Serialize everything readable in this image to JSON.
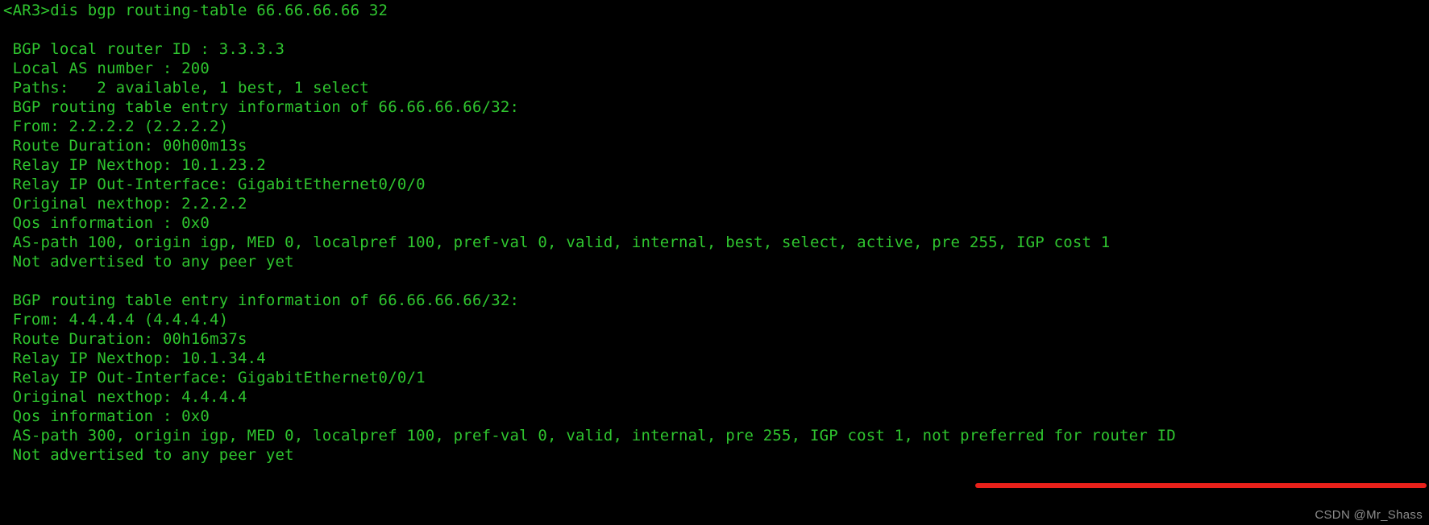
{
  "terminal": {
    "background_color": "#000000",
    "text_color": "#2fc52f",
    "annotation_color": "#e8201a",
    "watermark_color": "#8d8d8d",
    "prompt": "<AR3>",
    "command": "dis bgp routing-table 66.66.66.66 32",
    "command_line": "<AR3>dis bgp routing-table 66.66.66.66 32",
    "lines": [
      "<AR3>dis bgp routing-table 66.66.66.66 32",
      "",
      " BGP local router ID : 3.3.3.3",
      " Local AS number : 200",
      " Paths:   2 available, 1 best, 1 select",
      " BGP routing table entry information of 66.66.66.66/32:",
      " From: 2.2.2.2 (2.2.2.2)",
      " Route Duration: 00h00m13s",
      " Relay IP Nexthop: 10.1.23.2",
      " Relay IP Out-Interface: GigabitEthernet0/0/0",
      " Original nexthop: 2.2.2.2",
      " Qos information : 0x0",
      " AS-path 100, origin igp, MED 0, localpref 100, pref-val 0, valid, internal, best, select, active, pre 255, IGP cost 1",
      " Not advertised to any peer yet",
      "",
      " BGP routing table entry information of 66.66.66.66/32:",
      " From: 4.4.4.4 (4.4.4.4)",
      " Route Duration: 00h16m37s",
      " Relay IP Nexthop: 10.1.34.4",
      " Relay IP Out-Interface: GigabitEthernet0/0/1",
      " Original nexthop: 4.4.4.4",
      " Qos information : 0x0",
      " AS-path 300, origin igp, MED 0, localpref 100, pref-val 0, valid, internal, pre 255, IGP cost 1, not preferred for router ID",
      " Not advertised to any peer yet"
    ],
    "summary": {
      "bgp_local_router_id_label": "BGP local router ID",
      "bgp_local_router_id": "3.3.3.3",
      "local_as_number_label": "Local AS number",
      "local_as_number": "200",
      "paths_label": "Paths:",
      "paths_available": "2 available",
      "paths_best": "1 best",
      "paths_select": "1 select"
    },
    "entries": [
      {
        "header": "BGP routing table entry information of 66.66.66.66/32:",
        "prefix": "66.66.66.66/32",
        "from": "2.2.2.2 (2.2.2.2)",
        "route_duration": "00h00m13s",
        "relay_ip_nexthop": "10.1.23.2",
        "relay_ip_out_interface": "GigabitEthernet0/0/0",
        "original_nexthop": "2.2.2.2",
        "qos_information": "0x0",
        "as_path_line": "AS-path 100, origin igp, MED 0, localpref 100, pref-val 0, valid, internal, best, select, active, pre 255, IGP cost 1",
        "as_path": "100",
        "origin": "igp",
        "med": "0",
        "localpref": "100",
        "pref_val": "0",
        "flags": "valid, internal, best, select, active",
        "pre": "255",
        "igp_cost": "1",
        "advertised": "Not advertised to any peer yet"
      },
      {
        "header": "BGP routing table entry information of 66.66.66.66/32:",
        "prefix": "66.66.66.66/32",
        "from": "4.4.4.4 (4.4.4.4)",
        "route_duration": "00h16m37s",
        "relay_ip_nexthop": "10.1.34.4",
        "relay_ip_out_interface": "GigabitEthernet0/0/1",
        "original_nexthop": "4.4.4.4",
        "qos_information": "0x0",
        "as_path_line": "AS-path 300, origin igp, MED 0, localpref 100, pref-val 0, valid, internal, pre 255, IGP cost 1, not preferred for router ID",
        "as_path": "300",
        "origin": "igp",
        "med": "0",
        "localpref": "100",
        "pref_val": "0",
        "flags": "valid, internal",
        "pre": "255",
        "igp_cost": "1",
        "reason": "not preferred for router ID",
        "advertised": "Not advertised to any peer yet"
      }
    ]
  },
  "annotation": {
    "underline_target": "not preferred for router ID"
  },
  "watermark": {
    "text": "CSDN @Mr_Shass"
  }
}
